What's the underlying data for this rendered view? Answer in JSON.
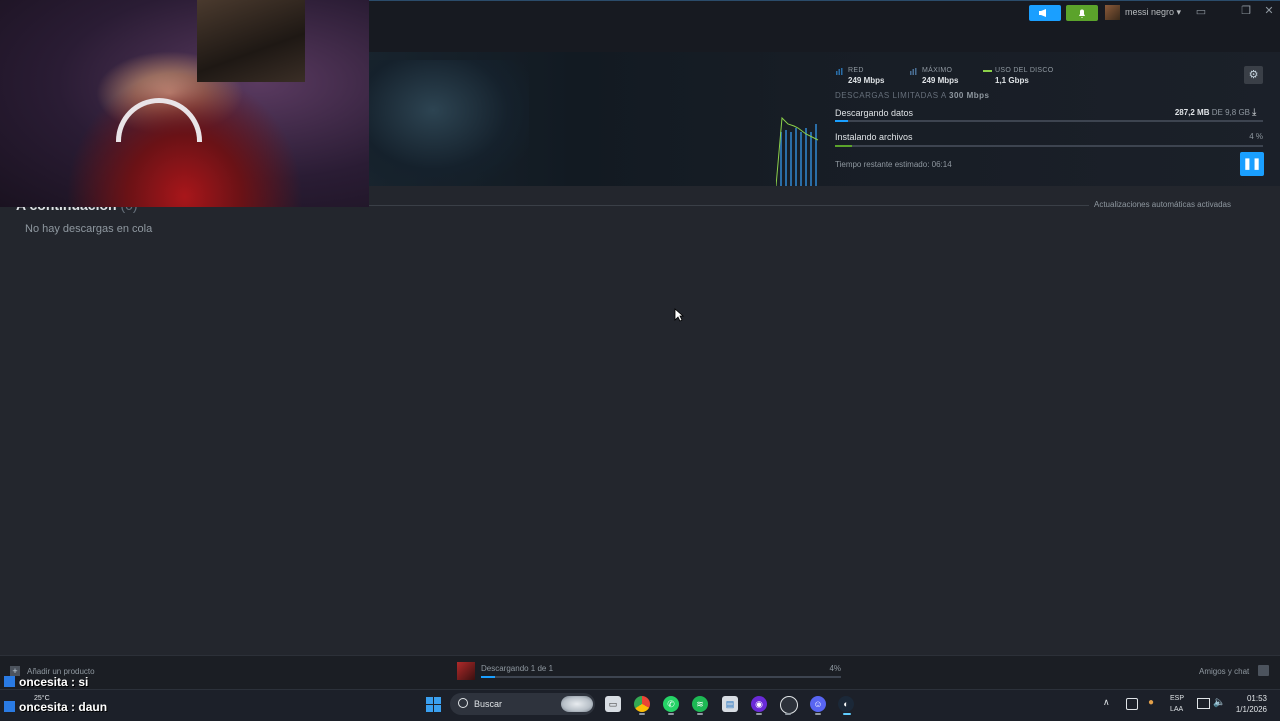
{
  "titlebar": {
    "username": "messi negro",
    "announce_icon": "megaphone-icon",
    "notify_icon": "bell-icon"
  },
  "stats": {
    "net_label": "RED",
    "net_value": "249 Mbps",
    "peak_label": "MÁXIMO",
    "peak_value": "249 Mbps",
    "disk_label": "USO DEL DISCO",
    "disk_value": "1,1 Gbps",
    "limit_prefix": "DESCARGAS LIMITADAS A",
    "limit_value": "300 Mbps"
  },
  "download": {
    "downloading_label": "Descargando datos",
    "downloaded": "287,2 MB",
    "of_label": "DE",
    "total": "9,8 GB",
    "download_progress": 0.03,
    "installing_label": "Instalando archivos",
    "install_pct": "4 %",
    "install_progress": 0.04,
    "eta_label": "Tiempo restante estimado:",
    "eta_value": "06:14"
  },
  "queue": {
    "title": "A continuación",
    "count": "(0)",
    "empty_text": "No hay descargas en cola",
    "auto_updates": "Actualizaciones automáticas activadas"
  },
  "bottombar": {
    "add_product": "Añadir un producto",
    "dl_status": "Descargando 1 de 1",
    "dl_pct": "4%",
    "dl_progress": 0.04,
    "friends": "Amigos y chat"
  },
  "chat": [
    {
      "user": "oncesita",
      "message": "si"
    },
    {
      "user": "oncesita",
      "message": "daun"
    }
  ],
  "taskbar": {
    "weather_temp": "25°C",
    "search_placeholder": "Buscar",
    "lang_top": "ESP",
    "lang_bottom": "LAA",
    "time": "01:53",
    "date": "1/1/2026"
  },
  "colors": {
    "accent_blue": "#1a9fff",
    "accent_green": "#5ba32b",
    "background": "#23262d"
  }
}
